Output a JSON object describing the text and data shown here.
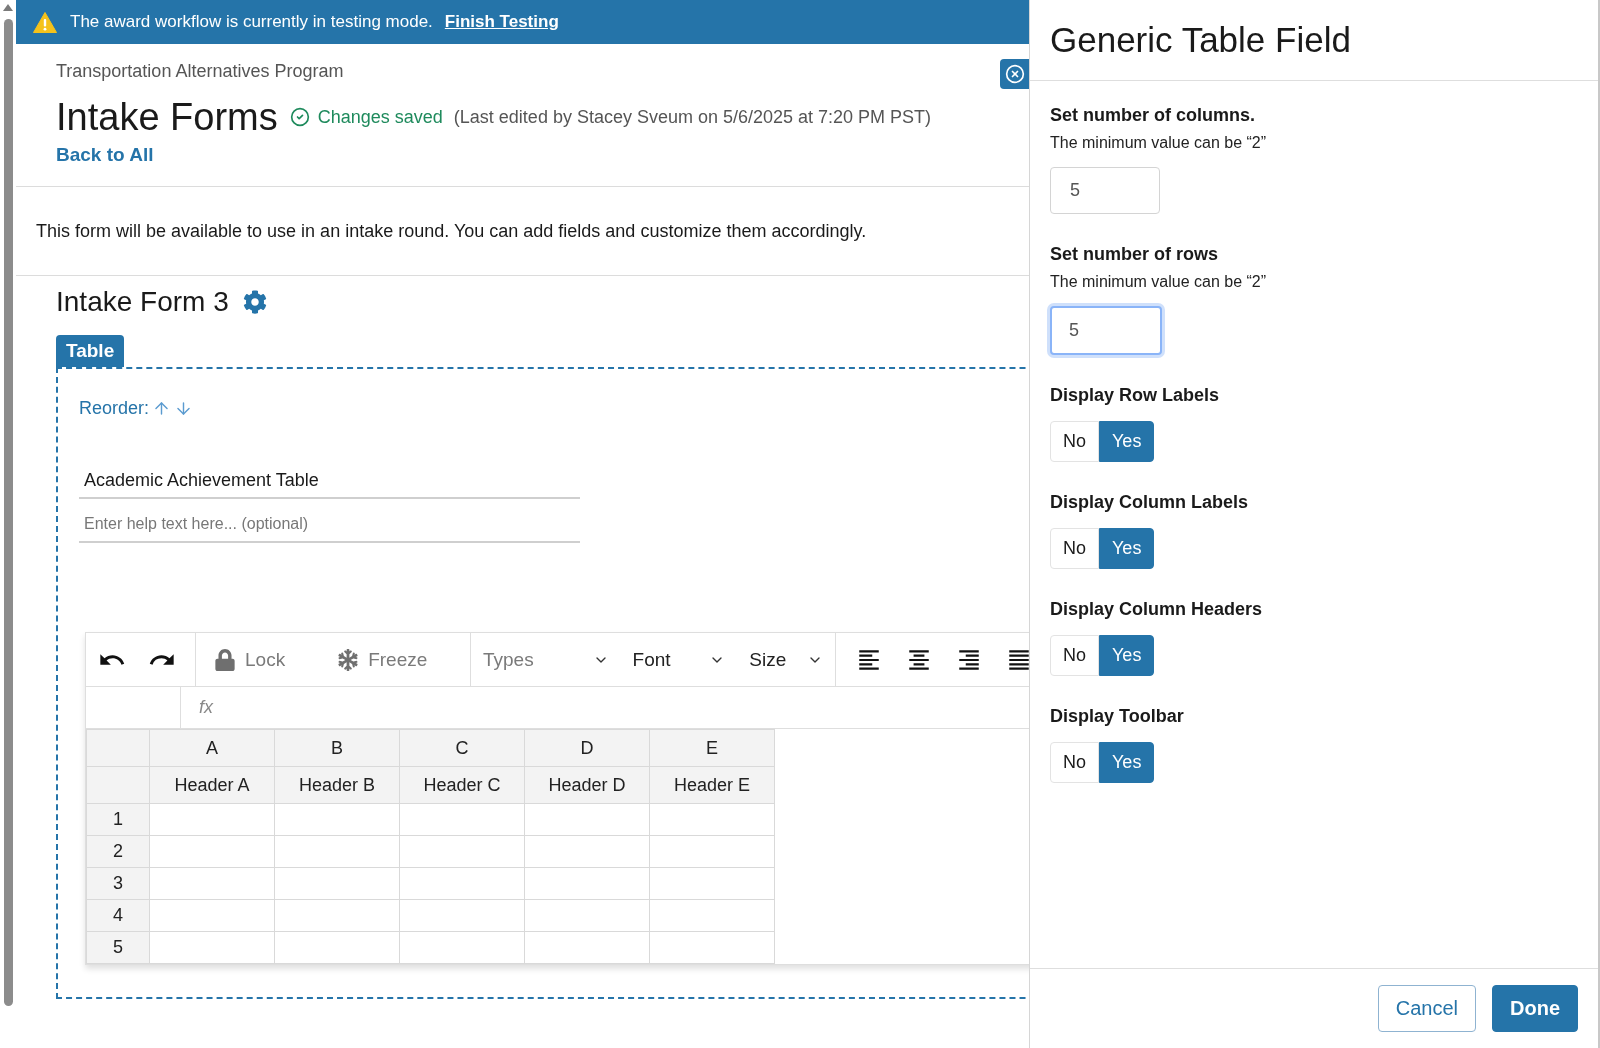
{
  "banner": {
    "message": "The award workflow is currently in testing mode.",
    "link": "Finish Testing"
  },
  "header": {
    "program": "Transportation Alternatives Program",
    "title": "Intake Forms",
    "save_status": "Changes saved",
    "last_edited": "(Last edited by Stacey Sveum on 5/6/2025 at 7:20 PM PST)",
    "back_link": "Back to All"
  },
  "description": "This form will be available to use in an intake round. You can add fields and customize them accordingly.",
  "form": {
    "title": "Intake Form 3",
    "field": {
      "tab": "Table",
      "reorder_label": "Reorder:",
      "label_input": {
        "value": "Academic Achievement Table"
      },
      "help_input": {
        "placeholder": "Enter help text here... (optional)"
      },
      "spreadsheet": {
        "toolbar": {
          "tools": [
            {
              "kind": "lock",
              "label": "Lock",
              "disabled": true
            },
            {
              "kind": "freeze",
              "label": "Freeze",
              "disabled": true
            }
          ],
          "dropdowns": [
            {
              "label": "Types",
              "disabled": true
            },
            {
              "label": "Font",
              "disabled": false
            },
            {
              "label": "Size",
              "disabled": false
            }
          ]
        },
        "formula_bar": {
          "label": "fx"
        },
        "column_letters": [
          "A",
          "B",
          "C",
          "D",
          "E"
        ],
        "column_headers": [
          "Header A",
          "Header B",
          "Header C",
          "Header D",
          "Header E"
        ],
        "row_labels": [
          "1",
          "2",
          "3",
          "4",
          "5"
        ]
      }
    }
  },
  "panel": {
    "title": "Generic Table Field",
    "number_fields": [
      {
        "label": "Set number of columns.",
        "hint": "The minimum value can be “2”",
        "value": "5",
        "focused": false
      },
      {
        "label": "Set number of rows",
        "hint": "The minimum value can be “2”",
        "value": "5",
        "focused": true
      }
    ],
    "toggles": [
      {
        "label": "Display Row Labels",
        "options": [
          {
            "label": "No",
            "selected": false
          },
          {
            "label": "Yes",
            "selected": true
          }
        ]
      },
      {
        "label": "Display Column Labels",
        "options": [
          {
            "label": "No",
            "selected": false
          },
          {
            "label": "Yes",
            "selected": true
          }
        ]
      },
      {
        "label": "Display Column Headers",
        "options": [
          {
            "label": "No",
            "selected": false
          },
          {
            "label": "Yes",
            "selected": true
          }
        ]
      },
      {
        "label": "Display Toolbar",
        "options": [
          {
            "label": "No",
            "selected": false
          },
          {
            "label": "Yes",
            "selected": true
          }
        ]
      }
    ],
    "buttons": [
      {
        "kind": "secondary",
        "label": "Cancel"
      },
      {
        "kind": "primary",
        "label": "Done"
      }
    ]
  }
}
